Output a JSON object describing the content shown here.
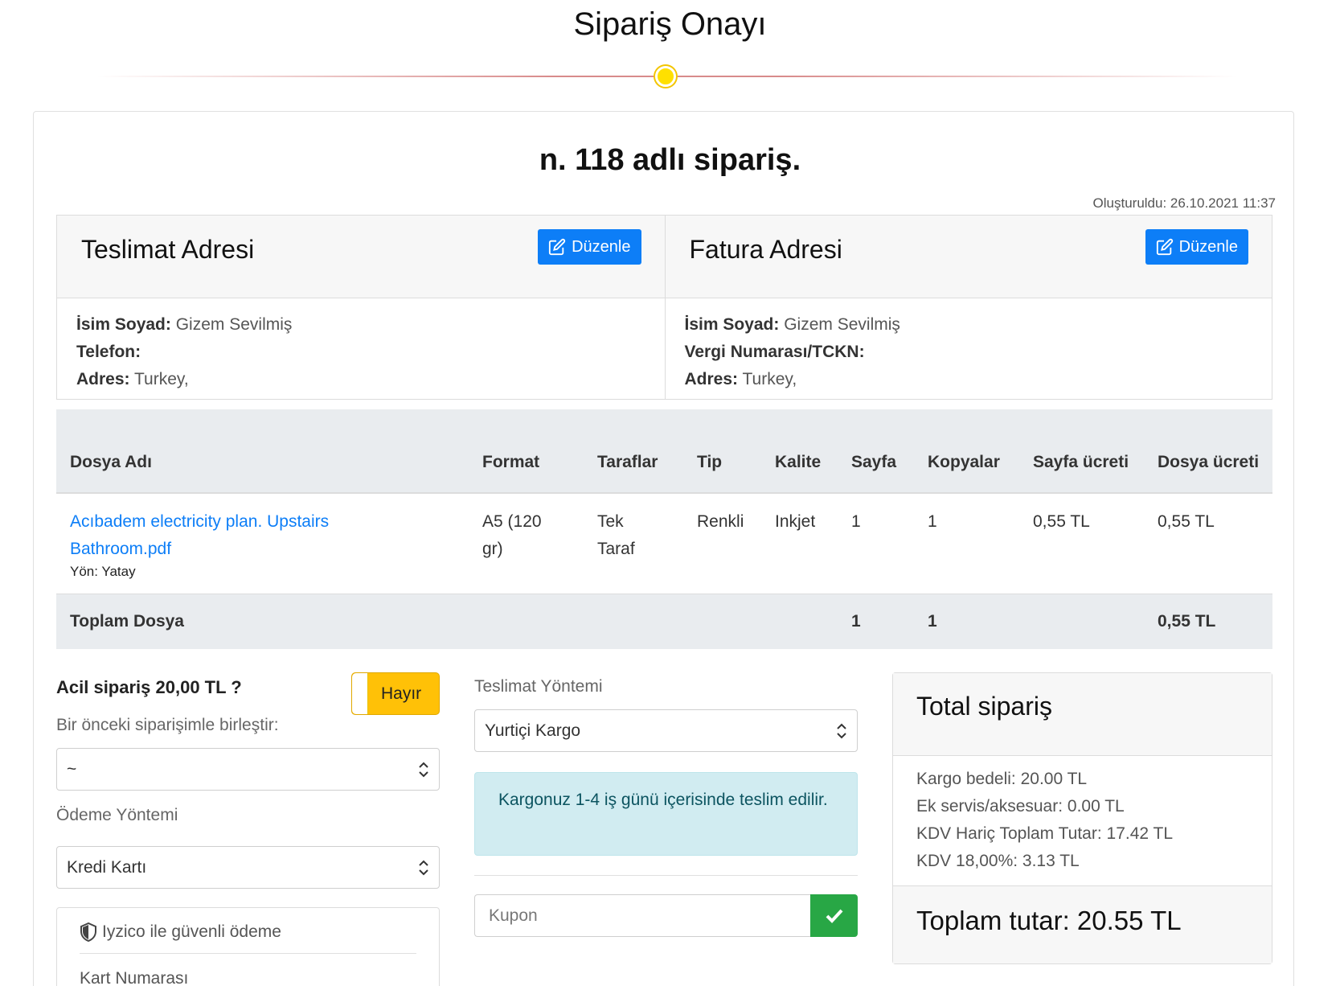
{
  "header": {
    "title": "Sipariş Onayı"
  },
  "order": {
    "title": "n. 118 adlı sipariş.",
    "created": "Oluşturuldu: 26.10.2021 11:37"
  },
  "shipping": {
    "title": "Teslimat Adresi",
    "edit_label": "Düzenle",
    "name_label": "İsim Soyad:",
    "name_value": "Gizem Sevilmiş",
    "phone_label": "Telefon:",
    "phone_value": "",
    "address_label": "Adres:",
    "address_value": "Turkey,"
  },
  "billing": {
    "title": "Fatura Adresi",
    "edit_label": "Düzenle",
    "name_label": "İsim Soyad:",
    "name_value": "Gizem Sevilmiş",
    "tax_label": "Vergi Numarası/TCKN:",
    "tax_value": "",
    "address_label": "Adres:",
    "address_value": "Turkey,"
  },
  "files_table": {
    "headers": {
      "file_name": "Dosya Adı",
      "format": "Format",
      "sides": "Taraflar",
      "type": "Tip",
      "quality": "Kalite",
      "pages": "Sayfa",
      "copies": "Kopyalar",
      "page_fee": "Sayfa ücreti",
      "file_fee": "Dosya ücreti"
    },
    "rows": [
      {
        "file_name": "Acıbadem electricity plan. Upstairs Bathroom.pdf",
        "orientation": "Yön: Yatay",
        "format": "A5 (120 gr)",
        "sides": "Tek Taraf",
        "type": "Renkli",
        "quality": "Inkjet",
        "pages": "1",
        "copies": "1",
        "page_fee": "0,55 TL",
        "file_fee": "0,55 TL"
      }
    ],
    "footer": {
      "label": "Toplam Dosya",
      "pages": "1",
      "copies": "1",
      "file_fee": "0,55 TL"
    }
  },
  "urgent": {
    "label": "Acil sipariş 20,00 TL ?",
    "toggle_value": "Hayır"
  },
  "merge": {
    "label": "Bir önceki siparişimle birleştir:",
    "selected": "~"
  },
  "payment": {
    "label": "Ödeme Yöntemi",
    "selected": "Kredi Kartı"
  },
  "iyzico": {
    "title": "Iyzico ile güvenli ödeme",
    "card_number_label": "Kart Numarası"
  },
  "delivery": {
    "label": "Teslimat Yöntemi",
    "selected": "Yurtiçi Kargo",
    "info": "Kargonuz 1-4 iş günü içerisinde teslim edilir."
  },
  "coupon": {
    "placeholder": "Kupon"
  },
  "total": {
    "title": "Total sipariş",
    "lines": [
      "Kargo bedeli: 20.00 TL",
      "Ek servis/aksesuar: 0.00 TL",
      "KDV Hariç Toplam Tutar: 17.42 TL",
      "KDV 18,00%: 3.13 TL"
    ],
    "grand_total": "Toplam tutar: 20.55 TL"
  },
  "colors": {
    "primary": "#0d7ef7",
    "warning": "#ffc107",
    "success": "#28a745",
    "info_bg": "#d1ecf1",
    "info_text": "#0c5460"
  }
}
